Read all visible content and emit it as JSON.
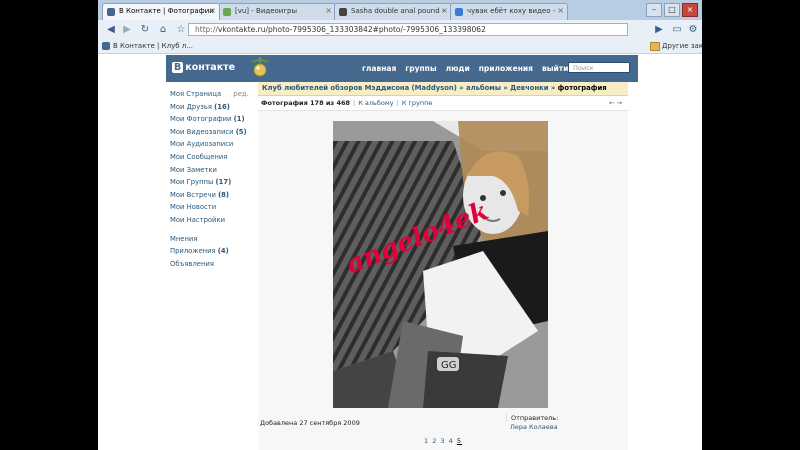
{
  "tabs": [
    {
      "label": "В Контакте | Фотографии",
      "active": true,
      "favicon_color": "#45688e"
    },
    {
      "label": "[vu] - Видеоигры",
      "active": false,
      "favicon_color": "#6aa84f"
    },
    {
      "label": "Sasha double anal pound -",
      "active": false,
      "favicon_color": "#444444"
    },
    {
      "label": "чувак ебёт коху видео -",
      "active": false,
      "favicon_color": "#3d7ad6"
    }
  ],
  "window_controls": {
    "minimize": "–",
    "maximize": "□",
    "close": "×"
  },
  "toolbar": {
    "back": "◀",
    "forward": "▶",
    "reload": "↻",
    "home": "⌂",
    "star": "☆",
    "url_scheme": "http://",
    "url_rest": "vkontakte.ru/photo-7995306_133303842#photo/-7995306_133398062",
    "go": "▶",
    "page_menu": "▭",
    "tools_menu": "⚙"
  },
  "bookmarks": {
    "item": "В Контакте | Клуб л...",
    "other": "Другие закл"
  },
  "vk": {
    "logo_b": "В",
    "logo_text": "контакте",
    "nav": [
      "главная",
      "группы",
      "люди",
      "приложения",
      "выйти"
    ],
    "search_placeholder": "Поиск"
  },
  "sidebar": {
    "items": [
      {
        "label": "Моя Страница",
        "count": "",
        "extra": "ред."
      },
      {
        "label": "Мои Друзья",
        "count": "(16)",
        "extra": ""
      },
      {
        "label": "Мои Фотографии",
        "count": "(1)",
        "extra": ""
      },
      {
        "label": "Мои Видеозаписи",
        "count": "(5)",
        "extra": ""
      },
      {
        "label": "Мои Аудиозаписи",
        "count": "",
        "extra": ""
      },
      {
        "label": "Мои Сообщения",
        "count": "",
        "extra": ""
      },
      {
        "label": "Мои Заметки",
        "count": "",
        "extra": ""
      },
      {
        "label": "Мои Группы",
        "count": "(17)",
        "extra": ""
      },
      {
        "label": "Мои Встречи",
        "count": "(8)",
        "extra": ""
      },
      {
        "label": "Мои Новости",
        "count": "",
        "extra": ""
      },
      {
        "label": "Мои Настройки",
        "count": "",
        "extra": ""
      }
    ],
    "secondary": [
      {
        "label": "Мнения",
        "count": ""
      },
      {
        "label": "Приложения",
        "count": "(4)"
      },
      {
        "label": "Объявления",
        "count": ""
      }
    ]
  },
  "breadcrumb": {
    "club": "Клуб любителей обзоров Мэддисона (Maddyson)",
    "albums": "альбомы",
    "album": "Девчонки",
    "current": "фотография",
    "sep": "»"
  },
  "photobar": {
    "counter": "Фотография 178 из 468",
    "to_album": "К альбому",
    "to_group": "К группе",
    "sep": "|",
    "prev": "←",
    "next": "→"
  },
  "photo": {
    "watermark": "angelo4ek"
  },
  "footer": {
    "added": "Добавлена 27 сентября 2009",
    "sender_label": "Отправитель:",
    "sender_name": "Лера Колаева"
  },
  "pager": {
    "pages": [
      "1",
      "2",
      "3",
      "4",
      "5"
    ],
    "current": "5"
  }
}
